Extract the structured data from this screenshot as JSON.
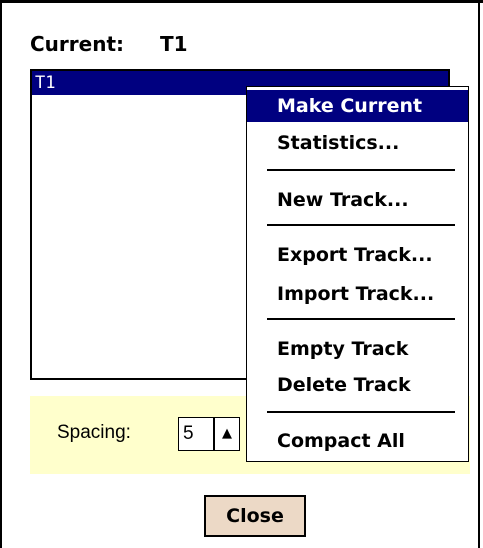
{
  "current": {
    "label": "Current:",
    "value": "T1"
  },
  "tracks": [
    {
      "name": "T1",
      "selected": true
    }
  ],
  "context_menu": {
    "items": [
      {
        "label": "Make Current",
        "highlighted": true
      },
      {
        "label": "Statistics..."
      },
      {
        "label": "New Track..."
      },
      {
        "label": "Export Track..."
      },
      {
        "label": "Import Track..."
      },
      {
        "label": "Empty Track"
      },
      {
        "label": "Delete Track"
      },
      {
        "label": "Compact All"
      }
    ]
  },
  "spacing": {
    "label": "Spacing:",
    "value": "5",
    "spin_up_icon": "triangle-up-icon"
  },
  "close_button": {
    "label": "Close"
  },
  "colors": {
    "selection": "#000080",
    "panel_bg": "#ffffcc",
    "button_bg": "#ecd9c6"
  }
}
